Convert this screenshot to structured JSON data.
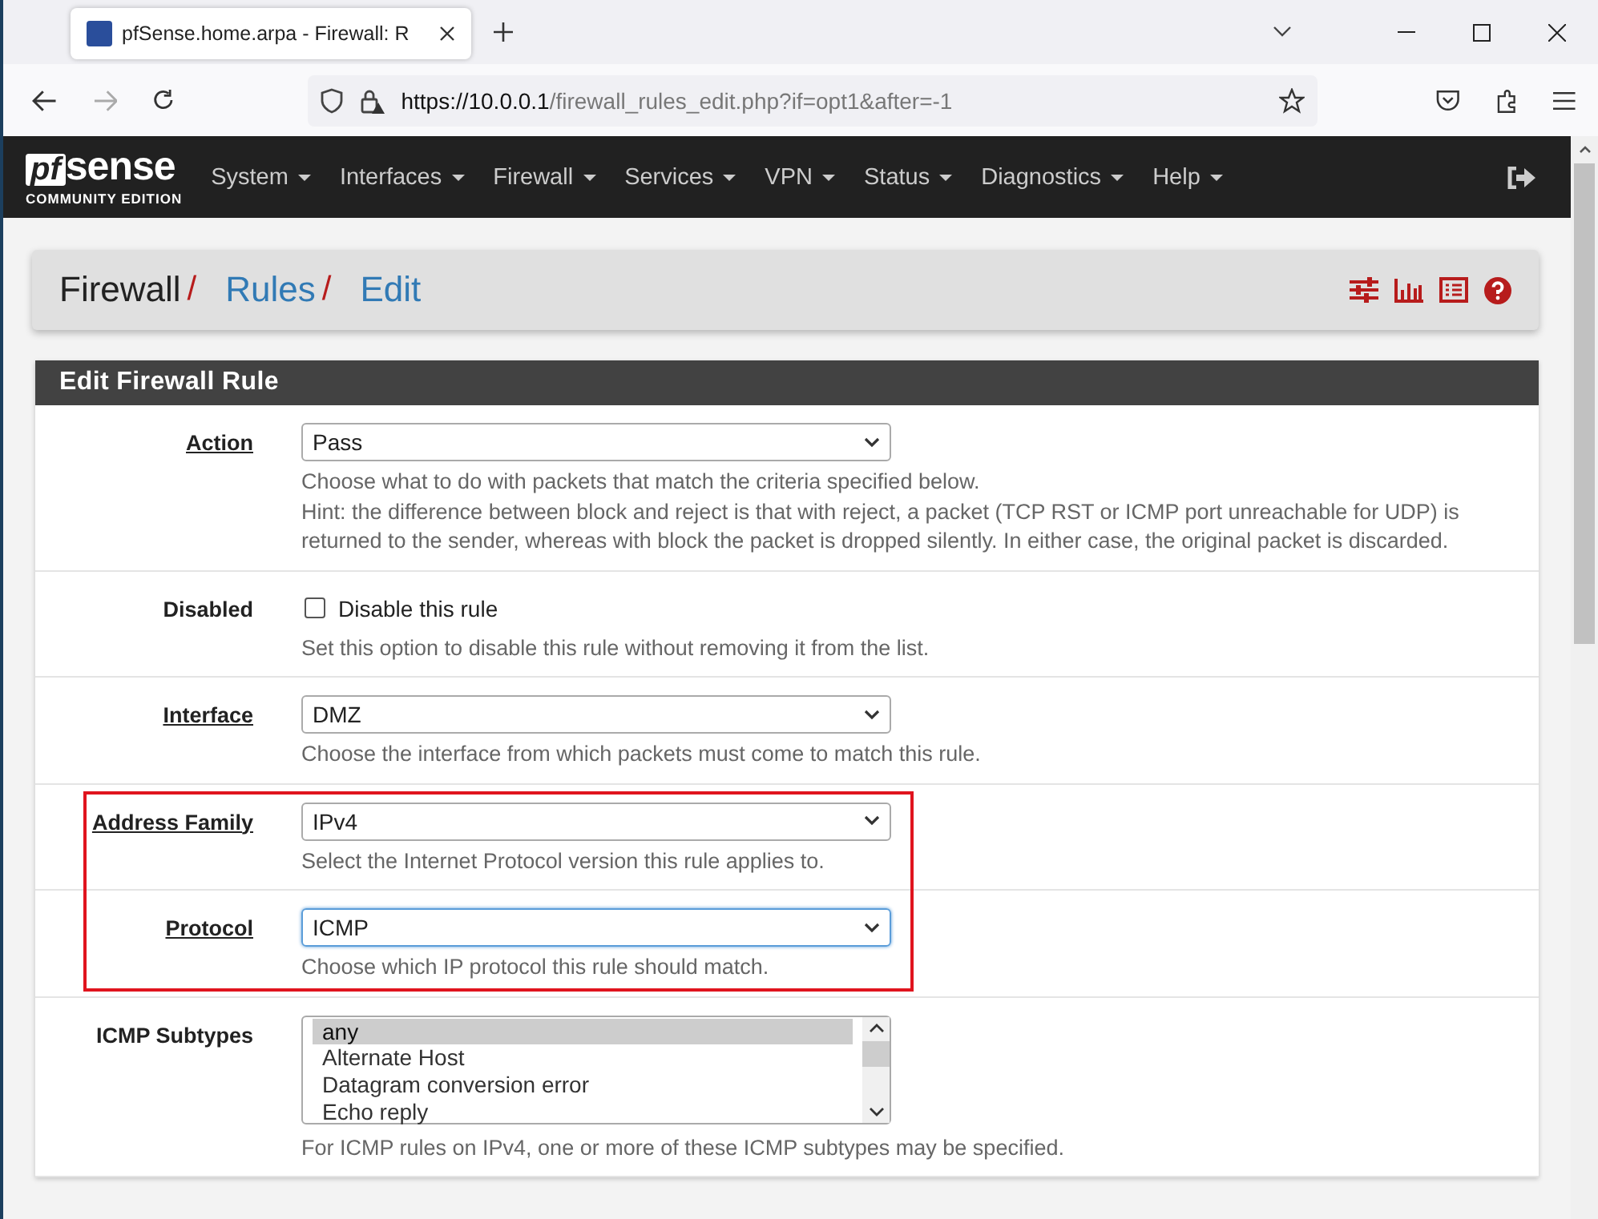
{
  "browser": {
    "tab_title": "pfSense.home.arpa - Firewall: R",
    "url_host": "https://10.0.0.1",
    "url_path": "/firewall_rules_edit.php?if=opt1&after=-1"
  },
  "nav": {
    "logo_word": "sense",
    "logo_mark": "pf",
    "logo_sub": "COMMUNITY EDITION",
    "menus": [
      "System",
      "Interfaces",
      "Firewall",
      "Services",
      "VPN",
      "Status",
      "Diagnostics",
      "Help"
    ]
  },
  "breadcrumb": [
    {
      "label": "Firewall",
      "link": false,
      "separator": "/"
    },
    {
      "label": "Rules",
      "link": true,
      "separator": "/"
    },
    {
      "label": "Edit",
      "link": true
    }
  ],
  "panel_title": "Edit Firewall Rule",
  "fields": [
    {
      "kind": "select",
      "label": "Action",
      "required": true,
      "highlighted": false,
      "value": "Pass",
      "focused": false,
      "help": [
        "Choose what to do with packets that match the criteria specified below.",
        "Hint: the difference between block and reject is that with reject, a packet (TCP RST or ICMP port unreachable for UDP) is returned to the sender, whereas with block the packet is dropped silently. In either case, the original packet is discarded."
      ]
    },
    {
      "kind": "checkbox",
      "label": "Disabled",
      "required": false,
      "highlighted": false,
      "checked": false,
      "text": "Disable this rule",
      "help": [
        "Set this option to disable this rule without removing it from the list."
      ]
    },
    {
      "kind": "select",
      "label": "Interface",
      "required": true,
      "highlighted": false,
      "value": "DMZ",
      "focused": false,
      "help": [
        "Choose the interface from which packets must come to match this rule."
      ]
    },
    {
      "kind": "select",
      "label": "Address Family",
      "required": true,
      "highlighted": true,
      "value": "IPv4",
      "focused": false,
      "help": [
        "Select the Internet Protocol version this rule applies to."
      ]
    },
    {
      "kind": "select",
      "label": "Protocol",
      "required": true,
      "highlighted": true,
      "value": "ICMP",
      "focused": true,
      "help": [
        "Choose which IP protocol this rule should match."
      ]
    },
    {
      "kind": "listbox",
      "label": "ICMP Subtypes",
      "required": false,
      "highlighted": false,
      "options": [
        {
          "label": "any",
          "selected": true
        },
        {
          "label": "Alternate Host",
          "selected": false
        },
        {
          "label": "Datagram conversion error",
          "selected": false
        },
        {
          "label": "Echo reply",
          "selected": false
        }
      ],
      "help": [
        "For ICMP rules on IPv4, one or more of these ICMP subtypes may be specified."
      ]
    }
  ]
}
